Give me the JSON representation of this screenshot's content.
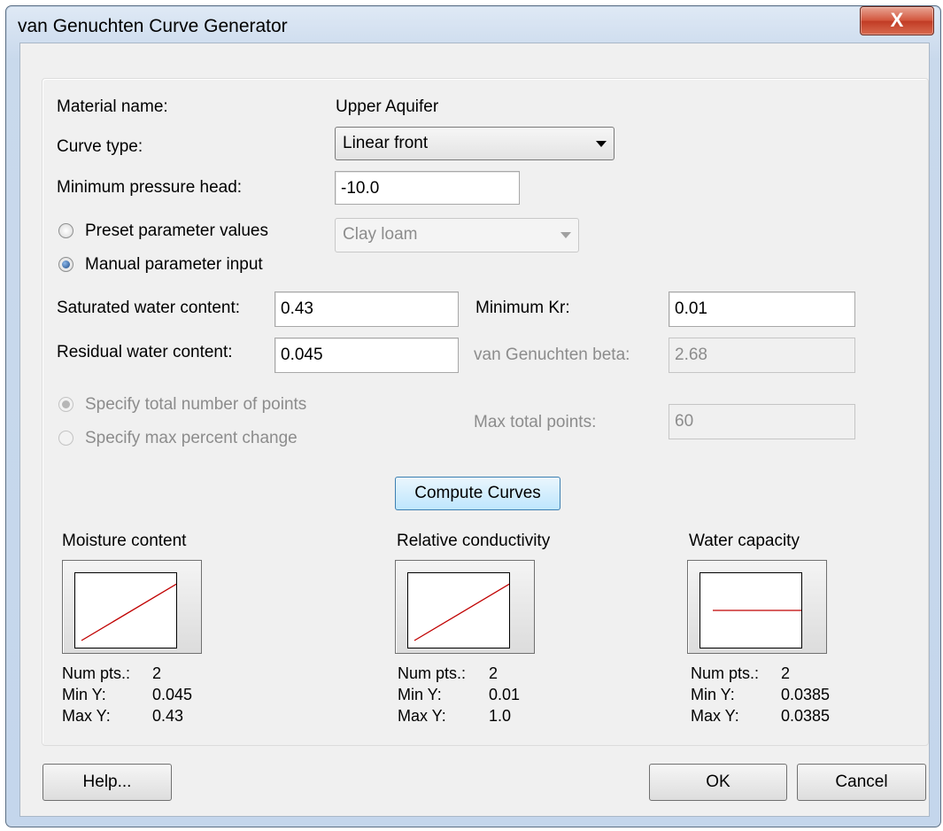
{
  "window": {
    "title": "van Genuchten Curve Generator",
    "close_label": "X"
  },
  "form": {
    "material_name_label": "Material name:",
    "material_name_value": "Upper Aquifer",
    "curve_type_label": "Curve type:",
    "curve_type_value": "Linear front",
    "min_pressure_head_label": "Minimum pressure head:",
    "min_pressure_head_value": "-10.0",
    "preset_radio_label": "Preset parameter values",
    "preset_value": "Clay loam",
    "manual_radio_label": "Manual parameter input",
    "param_mode": "manual",
    "saturated_label": "Saturated water content:",
    "saturated_value": "0.43",
    "residual_label": "Residual water content:",
    "residual_value": "0.045",
    "min_kr_label": "Minimum Kr:",
    "min_kr_value": "0.01",
    "beta_label": "van Genuchten beta:",
    "beta_value": "2.68",
    "total_points_radio_label": "Specify total number of points",
    "max_percent_radio_label": "Specify max percent change",
    "max_total_points_label": "Max total points:",
    "max_total_points_value": "60",
    "compute_button": "Compute Curves"
  },
  "curves": [
    {
      "title": "Moisture content",
      "line": "diagonal",
      "num_pts_label": "Num pts.:",
      "num_pts": "2",
      "min_y_label": "Min Y:",
      "min_y": "0.045",
      "max_y_label": "Max Y:",
      "max_y": "0.43"
    },
    {
      "title": "Relative conductivity",
      "line": "diagonal",
      "num_pts_label": "Num pts.:",
      "num_pts": "2",
      "min_y_label": "Min Y:",
      "min_y": "0.01",
      "max_y_label": "Max Y:",
      "max_y": "1.0"
    },
    {
      "title": "Water capacity",
      "line": "flat",
      "num_pts_label": "Num pts.:",
      "num_pts": "2",
      "min_y_label": "Min Y:",
      "min_y": "0.0385",
      "max_y_label": "Max Y:",
      "max_y": "0.0385"
    }
  ],
  "footer": {
    "help": "Help...",
    "ok": "OK",
    "cancel": "Cancel"
  },
  "colors": {
    "plot_line": "#c00000"
  }
}
